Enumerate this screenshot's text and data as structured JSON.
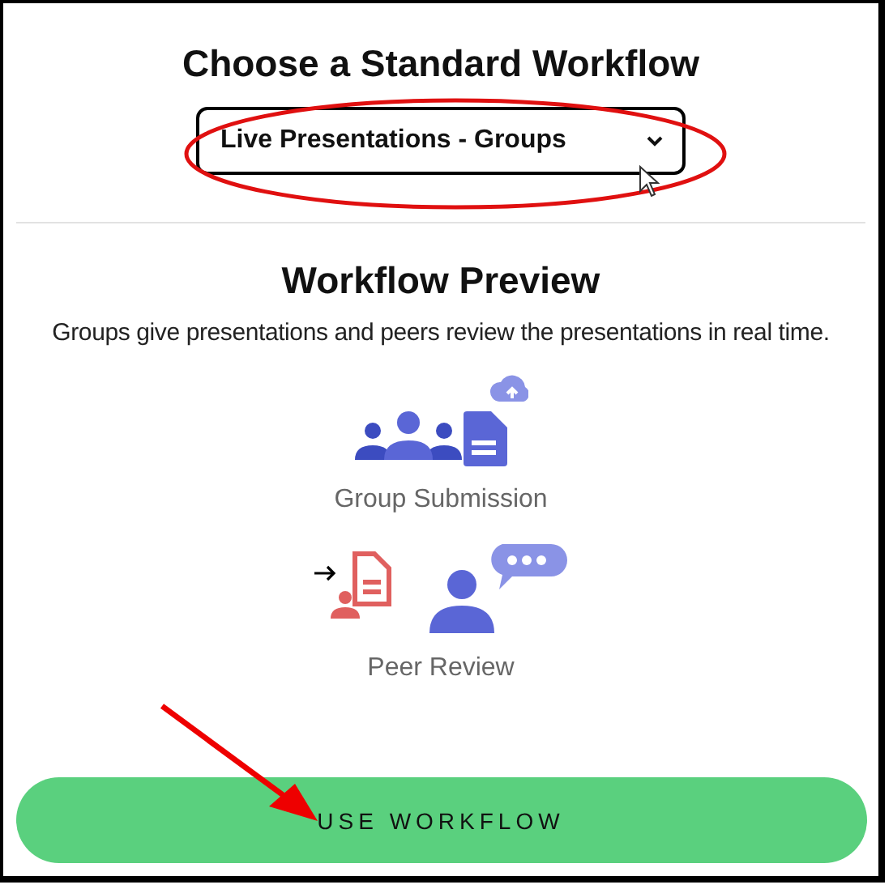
{
  "title": "Choose a Standard Workflow",
  "workflow_select": {
    "value": "Live Presentations - Groups"
  },
  "preview": {
    "heading": "Workflow Preview",
    "description": "Groups give presentations and peers review the presentations in real time.",
    "steps": [
      {
        "kind": "group-submission",
        "label": "Group Submission"
      },
      {
        "kind": "peer-review",
        "label": "Peer Review"
      }
    ]
  },
  "button": {
    "label": "USE WORKFLOW"
  }
}
